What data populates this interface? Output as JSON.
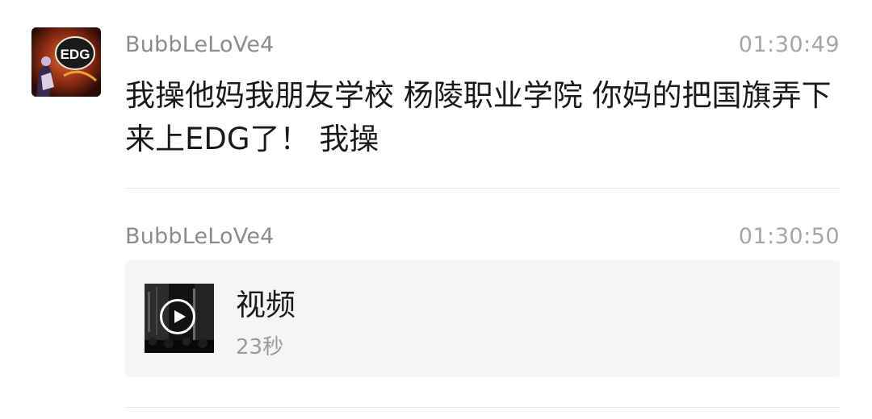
{
  "messages": [
    {
      "sender": "BubbLeLoVe4",
      "time": "01:30:49",
      "text": "我操他妈我朋友学校 杨陵职业学院 你妈的把国旗弄下来上EDG了！ 我操"
    },
    {
      "sender": "BubbLeLoVe4",
      "time": "01:30:50",
      "video": {
        "title": "视频",
        "duration": "23秒"
      }
    }
  ],
  "avatar": {
    "logo_text": "EDG",
    "colors": {
      "background": "#8a2a12",
      "accent": "#c24a14",
      "badge": "#1a1a1a"
    }
  },
  "colors": {
    "sender": "#8c8c8c",
    "time": "#a6a6a6",
    "text": "#1a1a1a",
    "card_background": "#f5f5f5",
    "divider": "#e6e6e6"
  },
  "icons": {
    "video_play": "play-icon"
  }
}
